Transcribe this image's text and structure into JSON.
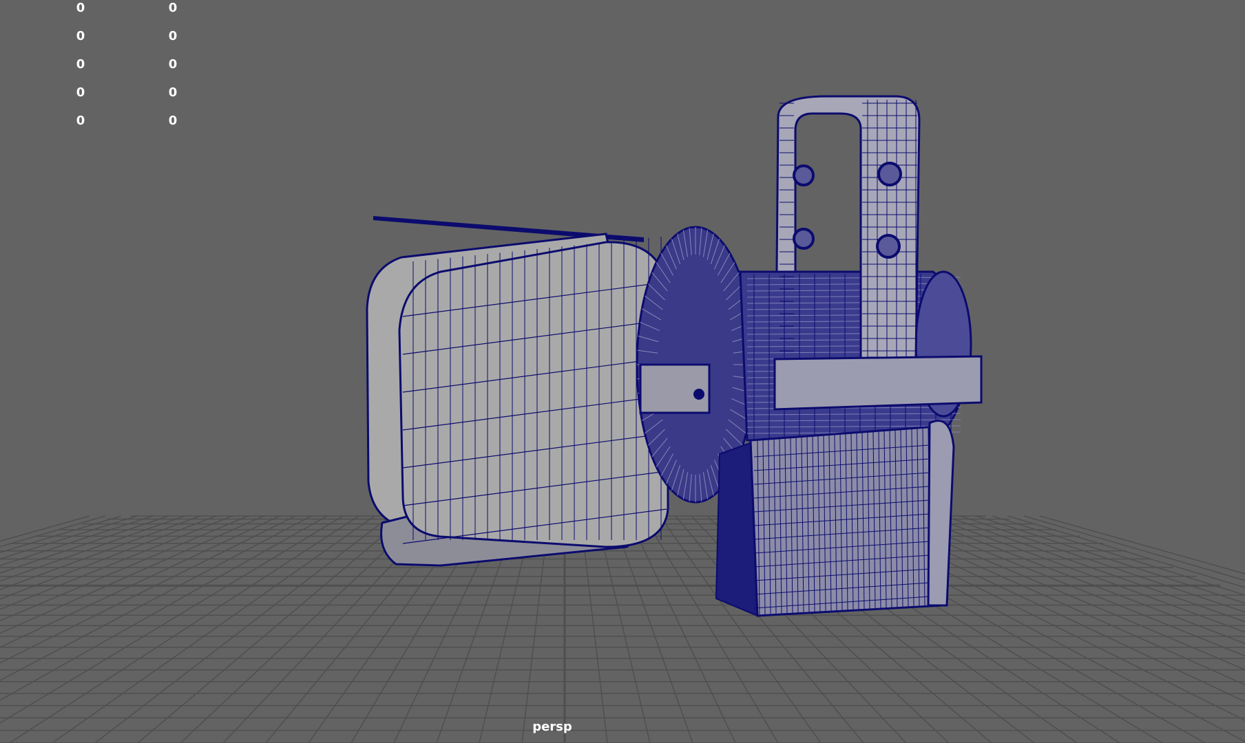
{
  "viewport": {
    "camera_name": "persp",
    "background_color": "#636363",
    "grid_color": "#4f4f4f",
    "wire_color": "#0b0b6e",
    "shaded_color": "#a9a9a9"
  },
  "hud": {
    "rows": [
      {
        "left": "0",
        "right": "0"
      },
      {
        "left": "0",
        "right": "0"
      },
      {
        "left": "0",
        "right": "0"
      },
      {
        "left": "0",
        "right": "0"
      },
      {
        "left": "0",
        "right": "0"
      }
    ]
  }
}
